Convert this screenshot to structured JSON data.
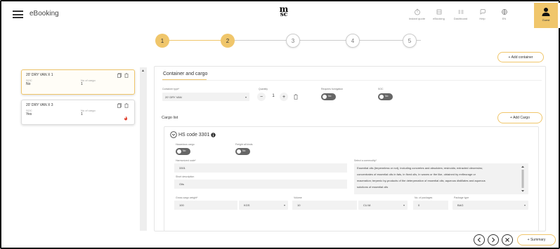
{
  "header": {
    "app_name": "eBooking",
    "logo_top": "m",
    "logo_bottom": "sc",
    "nav": [
      {
        "label": "Instant quote",
        "icon": "instant-quote-icon"
      },
      {
        "label": "eBooking",
        "icon": "ebooking-icon"
      },
      {
        "label": "Dashboard",
        "icon": "dashboard-icon"
      },
      {
        "label": "Help",
        "icon": "help-icon"
      },
      {
        "label": "EN",
        "icon": "globe-icon"
      }
    ],
    "user_label": "Guest"
  },
  "stepper": {
    "steps": [
      {
        "number": "1",
        "state": "done"
      },
      {
        "number": "2",
        "state": "current"
      },
      {
        "number": "3",
        "state": "todo"
      },
      {
        "number": "4",
        "state": "todo"
      },
      {
        "number": "5",
        "state": "todo"
      }
    ]
  },
  "add_container_label": "+ Add container",
  "containers": [
    {
      "title": "20' DRY VAN X 1",
      "soc_label": "SOC",
      "soc_value": "No",
      "cargo_label": "No of cargo",
      "cargo_value": "1",
      "active": true
    },
    {
      "title": "20' DRY VAN X 3",
      "soc_label": "SOC",
      "soc_value": "Yes",
      "cargo_label": "No of cargo",
      "cargo_value": "1",
      "active": false
    }
  ],
  "panel": {
    "tab_label": "Container and cargo",
    "container_type_label": "Container type*",
    "container_type_value": "20' DRY VAN",
    "quantity_label": "Quantity",
    "quantity_value": "1",
    "requires_fumigation_label": "Requires fumigation",
    "requires_fumigation_value": "No",
    "soc_label": "SOC",
    "soc_value": "No",
    "cargo_list_label": "Cargo list",
    "add_cargo_label": "+ Add Cargo"
  },
  "cargo": {
    "hs_title": "HS code 3301",
    "hazardous_label": "Hazardous cargo",
    "hazardous_value": "No",
    "freight_label": "Freight all kinds",
    "freight_value": "No",
    "harmonized_label": "Harmonized code*",
    "harmonized_value": "3301",
    "description_label": "Short description",
    "description_value": "Oils",
    "commodity_label": "Select a commodity*",
    "commodity_lines": [
      "Essential oils (terpeneless or not), including concretes and absolutes; resinoids; extracted oleoresins;",
      "concentrates of essential oils in fats, in fixed oils, in waxes or the like, obtained by enfleurage or",
      "maceration; terpenic by-products of the deterpenation of essential oils; aqueous distillates and aqueous",
      "solutions of essential oils"
    ],
    "weight_label": "Gross cargo weight*",
    "weight_value": "100",
    "weight_unit": "KGS",
    "volume_label": "Volume",
    "volume_value": "10",
    "volume_unit": "CU.M.",
    "packages_label": "No. of packages",
    "packages_value": "0",
    "package_type_label": "Package type",
    "package_type_value": "BAG"
  },
  "footer": {
    "summary_label": "+ Summary"
  },
  "colors": {
    "accent": "#f0c66b",
    "toggle": "#666666",
    "danger": "#e0402f"
  }
}
